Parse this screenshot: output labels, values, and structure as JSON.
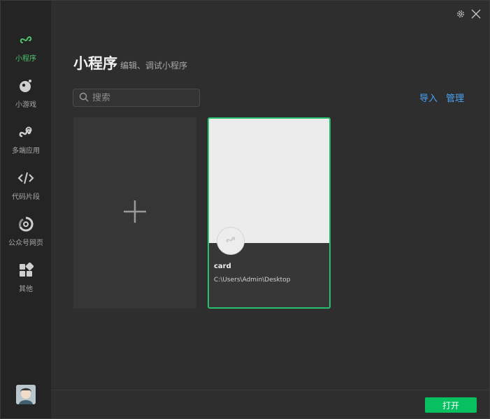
{
  "sidebar": {
    "items": [
      {
        "label": "小程序",
        "icon": "miniprogram-icon",
        "active": true
      },
      {
        "label": "小游戏",
        "icon": "minigame-icon",
        "active": false
      },
      {
        "label": "多端应用",
        "icon": "multiplatform-icon",
        "active": false
      },
      {
        "label": "代码片段",
        "icon": "code-snippet-icon",
        "active": false
      },
      {
        "label": "公众号网页",
        "icon": "official-account-web-icon",
        "active": false
      },
      {
        "label": "其他",
        "icon": "grid-icon",
        "active": false
      }
    ],
    "avatar": "avatar"
  },
  "header": {
    "title": "小程序",
    "subtitle": "编辑、调试小程序"
  },
  "search": {
    "placeholder": "搜索",
    "value": ""
  },
  "actions": {
    "import_label": "导入",
    "manage_label": "管理"
  },
  "projects": [
    {
      "name": "card",
      "path": "C:\\Users\\Admin\\Desktop"
    }
  ],
  "footer": {
    "open_label": "打开"
  },
  "colors": {
    "accent_green": "#07c160",
    "link_blue": "#4ba3f7",
    "selected_border": "#27c070",
    "active_nav": "#4fc36a"
  }
}
